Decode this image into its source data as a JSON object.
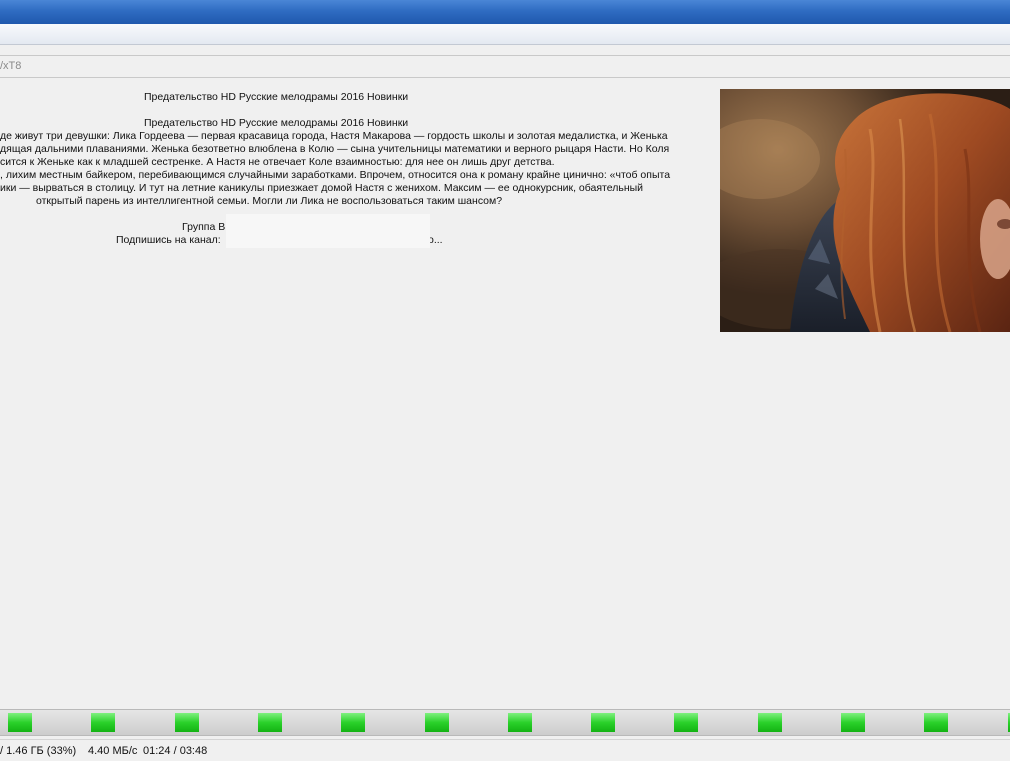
{
  "address": {
    "text": "/xT8"
  },
  "description": {
    "heading_1": "Предательство HD Русские мелодрамы 2016 Новинки",
    "heading_2": "Предательство HD Русские мелодрамы 2016 Новинки",
    "lines": [
      "де живут три девушки: Лика Гордеева — первая красавица города, Настя Макарова — гордость школы и золотая медалистка, и Женька",
      "дящая дальними плаваниями. Женька безответно влюблена в Колю — сына учительницы математики и верного рыцаря Насти. Но Коля",
      "сится к Женьке как к младшей сестренке. А Настя не отвечает Коле взаимностью: для нее он лишь друг детства.",
      ", лихим местным байкером, перебивающимся случайными заработками. Впрочем, относится она к роману крайне цинично: «чтоб опыта",
      "ики — вырваться в столицу. И тут на летние каникулы приезжает домой Настя с женихом. Максим — ее однокурсник, обаятельный",
      "открытый парень из интеллигентной семьи. Могли ли Лика не воспользоваться таким шансом?"
    ],
    "group_label": "Группа В",
    "subscribe_label": "Подпишись на канал:",
    "subscribe_tail": "о..."
  },
  "status": {
    "downloaded": "/ 1.46 ГБ (33%)",
    "speed": "4.40 МБ/с",
    "time": "01:24 / 03:48"
  },
  "progress": {
    "percent": 33,
    "pieces_count": 13
  },
  "colors": {
    "piece_green": "#2ad12a",
    "titlebar_blue": "#2f6cc2"
  }
}
